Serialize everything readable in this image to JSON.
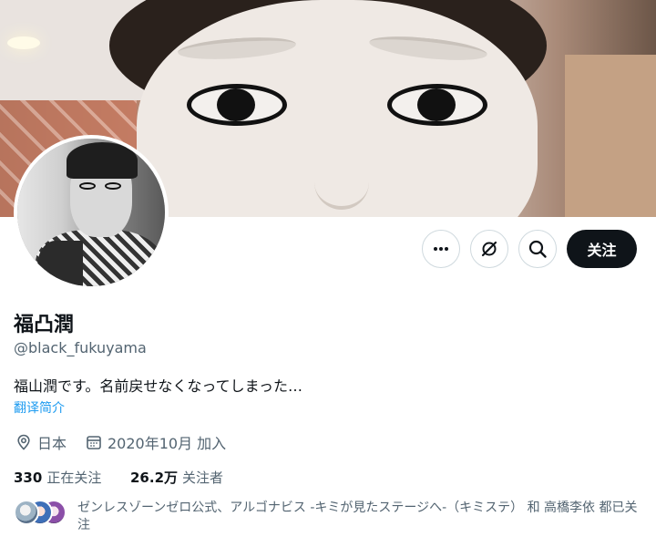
{
  "profile": {
    "display_name": "福凸潤",
    "handle": "@black_fukuyama",
    "bio": "福山潤です。名前戻せなくなってしまった…",
    "translate_link": "翻译简介",
    "location": "日本",
    "joined": "2020年10月 加入",
    "following_count": "330",
    "following_label": "正在关注",
    "followers_count": "26.2万",
    "followers_label": "关注者",
    "mutuals_text": "ゼンレスゾーンゼロ公式、アルゴナビス -キミが見たステージへ-（キミステ） 和 高橋李依 都已关注"
  },
  "actions": {
    "more_icon": "more-horizontal-icon",
    "grok_icon": "grok-icon",
    "search_icon": "search-icon",
    "follow_label": "关注"
  },
  "icons": {
    "location": "location-pin-icon",
    "calendar": "calendar-icon"
  },
  "colors": {
    "text_primary": "#0f1419",
    "text_secondary": "#536471",
    "link": "#1d9bf0",
    "follow_button_bg": "#0f1419",
    "follow_button_text": "#ffffff",
    "border": "#cfd9de"
  }
}
